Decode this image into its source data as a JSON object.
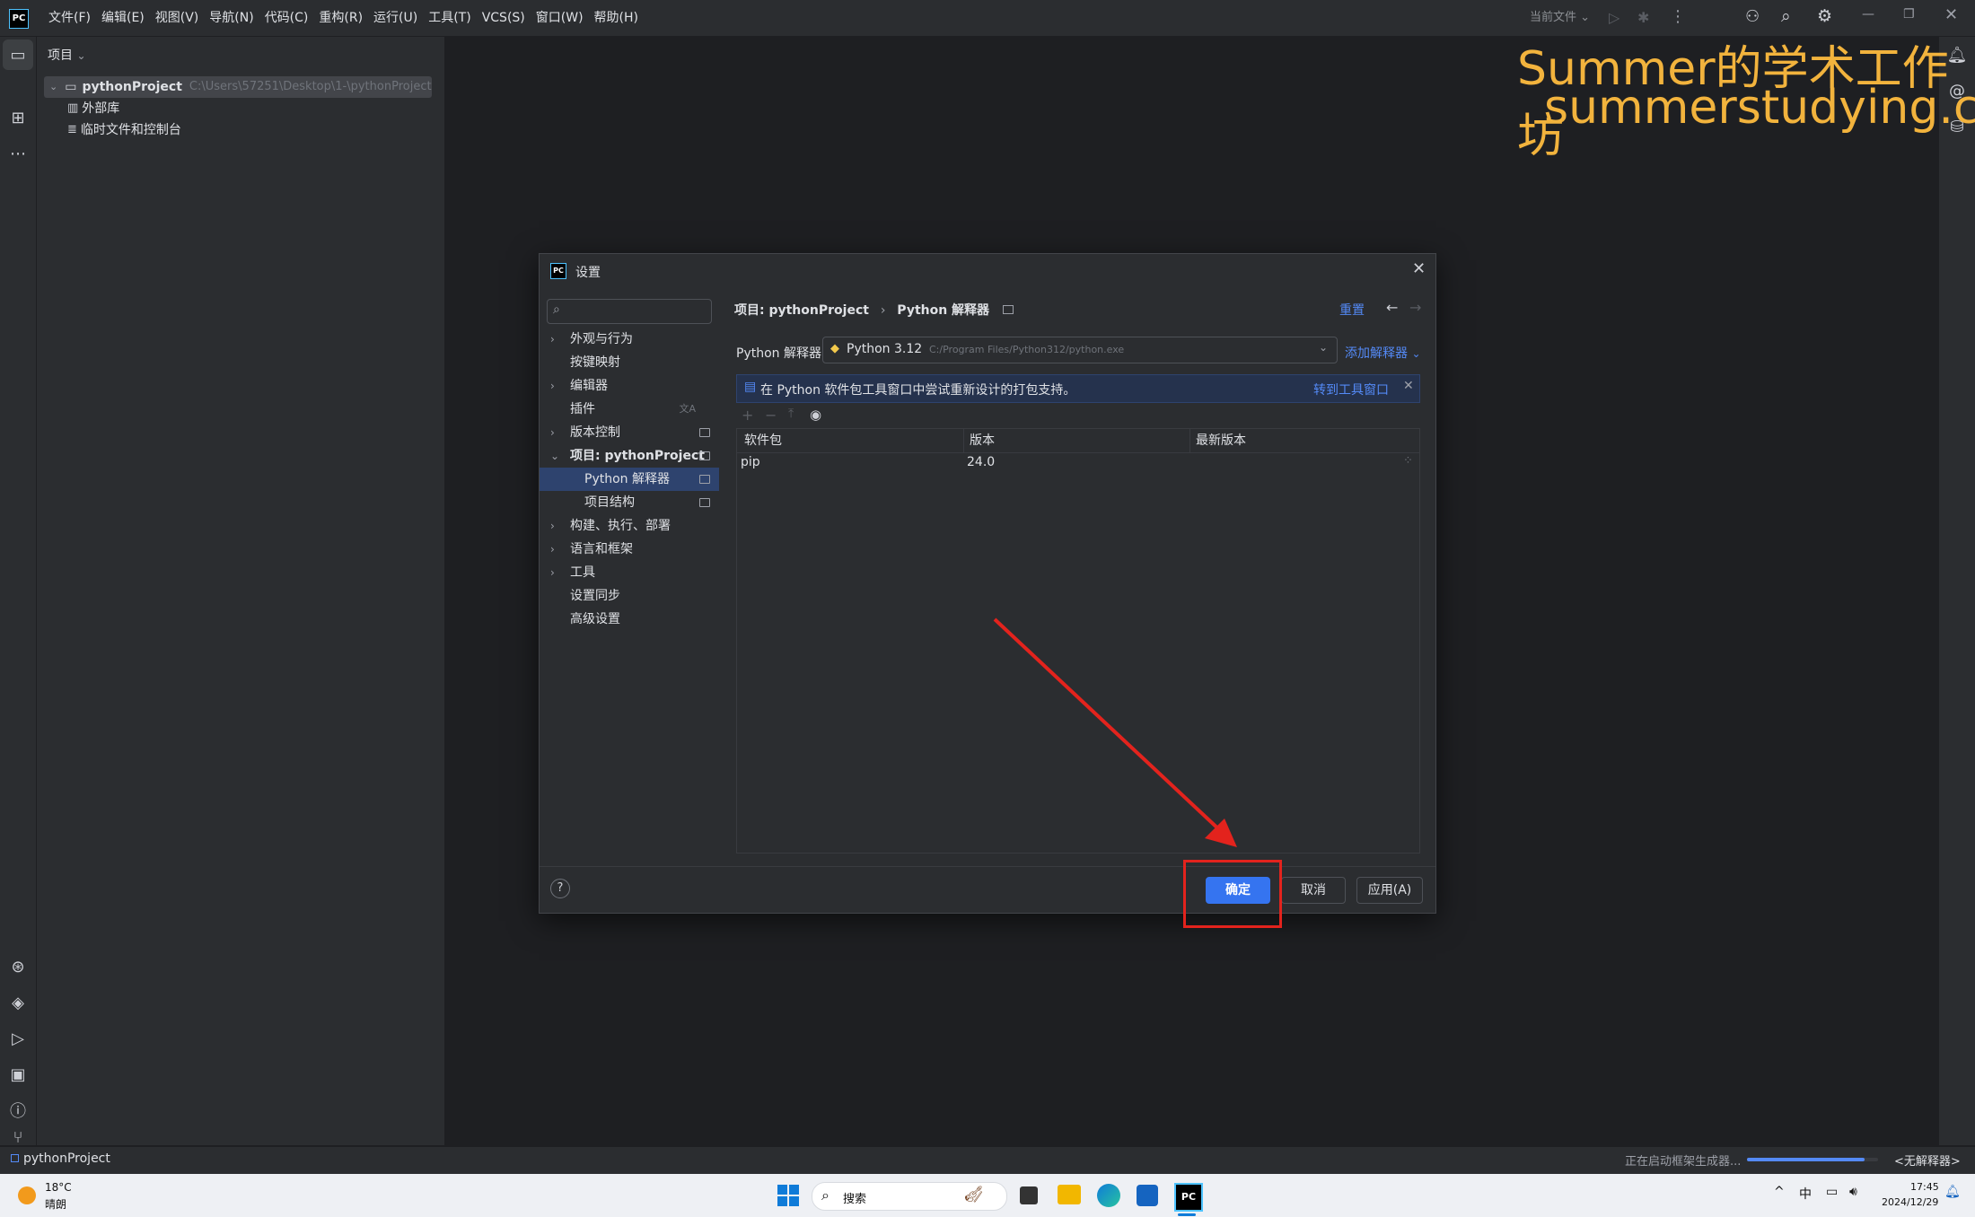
{
  "window": {
    "menu": [
      "文件(F)",
      "编辑(E)",
      "视图(V)",
      "导航(N)",
      "代码(C)",
      "重构(R)",
      "运行(U)",
      "工具(T)",
      "VCS(S)",
      "窗口(W)",
      "帮助(H)"
    ],
    "run_config": "当前文件",
    "logo_text": "PC"
  },
  "project_panel": {
    "title": "项目",
    "root_name": "pythonProject",
    "root_path": "C:\\Users\\57251\\Desktop\\1-\\pythonProject",
    "items": [
      "外部库",
      "临时文件和控制台"
    ]
  },
  "watermark": {
    "line1": "Summer的学术工作坊",
    "line2": "summerstudying.com"
  },
  "dialog": {
    "title": "设置",
    "search_placeholder": "",
    "nav": [
      {
        "label": "外观与行为",
        "chevron": "›"
      },
      {
        "label": "按键映射",
        "chevron": ""
      },
      {
        "label": "编辑器",
        "chevron": "›"
      },
      {
        "label": "插件",
        "chevron": ""
      },
      {
        "label": "版本控制",
        "chevron": "›"
      },
      {
        "label": "项目: pythonProject",
        "chevron": "⌄"
      },
      {
        "label": "Python 解释器",
        "chevron": ""
      },
      {
        "label": "项目结构",
        "chevron": ""
      },
      {
        "label": "构建、执行、部署",
        "chevron": "›"
      },
      {
        "label": "语言和框架",
        "chevron": "›"
      },
      {
        "label": "工具",
        "chevron": "›"
      },
      {
        "label": "设置同步",
        "chevron": ""
      },
      {
        "label": "高级设置",
        "chevron": ""
      }
    ],
    "breadcrumb_parent": "项目: pythonProject",
    "breadcrumb_sep": "›",
    "breadcrumb_current": "Python 解释器",
    "reset_label": "重置",
    "interpreter_label": "Python 解释器:",
    "interpreter_name": "Python 3.12",
    "interpreter_path": "C:/Program Files/Python312/python.exe",
    "add_interpreter": "添加解释器",
    "banner_text": "在 Python 软件包工具窗口中尝试重新设计的打包支持。",
    "banner_link": "转到工具窗口",
    "columns": [
      "软件包",
      "版本",
      "最新版本"
    ],
    "packages": [
      {
        "name": "pip",
        "version": "24.0",
        "latest": ""
      }
    ],
    "help_label": "?",
    "ok_label": "确定",
    "cancel_label": "取消",
    "apply_label": "应用(A)"
  },
  "statusbar": {
    "project": "pythonProject",
    "task": "正在启动框架生成器...",
    "task_progress": 0.9,
    "interpreter": "<无解释器>"
  },
  "taskbar": {
    "weather_temp": "18°C",
    "weather_desc": "晴朗",
    "search_label": "搜索",
    "ime": "中",
    "time": "17:45",
    "date": "2024/12/29"
  },
  "colors": {
    "accent": "#3574f0",
    "highlight_red": "#e3231d",
    "watermark": "#f2b33d"
  }
}
